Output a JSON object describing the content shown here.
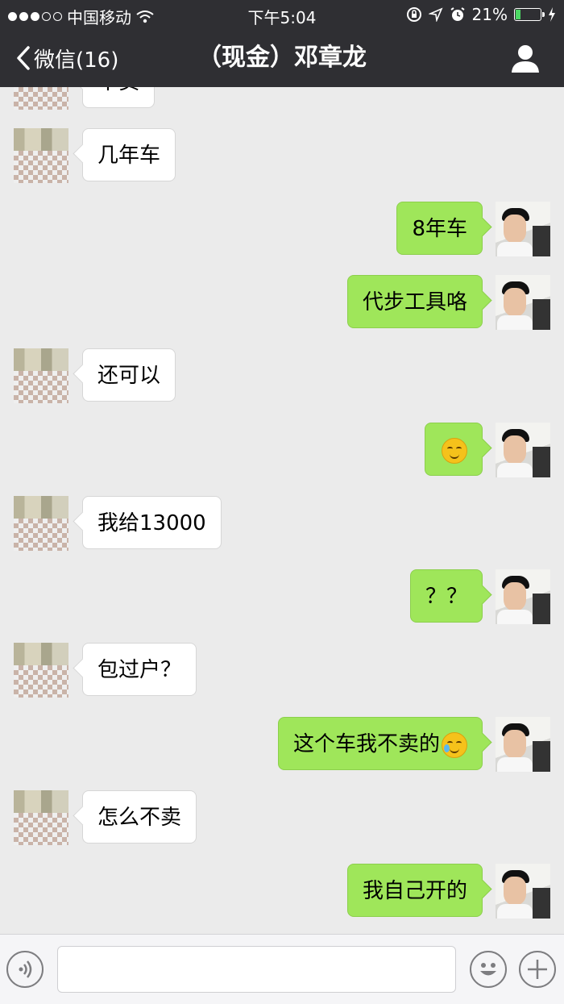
{
  "status_bar": {
    "carrier": "中国移动",
    "time": "下午5:04",
    "battery_percent": "21%",
    "battery_level": 0.21,
    "battery_color": "#4cd964"
  },
  "nav": {
    "back_label": "微信(16)",
    "title": "（现金）邓章龙"
  },
  "messages": [
    {
      "side": "in",
      "text": "不卖",
      "partial": true
    },
    {
      "side": "in",
      "text": "几年车"
    },
    {
      "side": "out",
      "text": "8年车"
    },
    {
      "side": "out",
      "text": "代步工具咯"
    },
    {
      "side": "in",
      "text": "还可以"
    },
    {
      "side": "out",
      "text": "",
      "emoji": "smirk-emoji"
    },
    {
      "side": "in",
      "text": "我给13000"
    },
    {
      "side": "out",
      "text": "？？"
    },
    {
      "side": "in",
      "text": "包过户？"
    },
    {
      "side": "out",
      "text": "这个车我不卖的",
      "emoji": "laugh-cry-emoji"
    },
    {
      "side": "in",
      "text": "怎么不卖"
    },
    {
      "side": "out",
      "text": "我自己开的"
    }
  ],
  "input_bar": {
    "text_value": "",
    "icons": [
      "voice-icon",
      "emoji-icon",
      "plus-icon"
    ]
  },
  "colors": {
    "header_bg": "#2f2f33",
    "chat_bg": "#ebebeb",
    "outgoing_bubble": "#9fe65a",
    "incoming_bubble": "#ffffff"
  }
}
